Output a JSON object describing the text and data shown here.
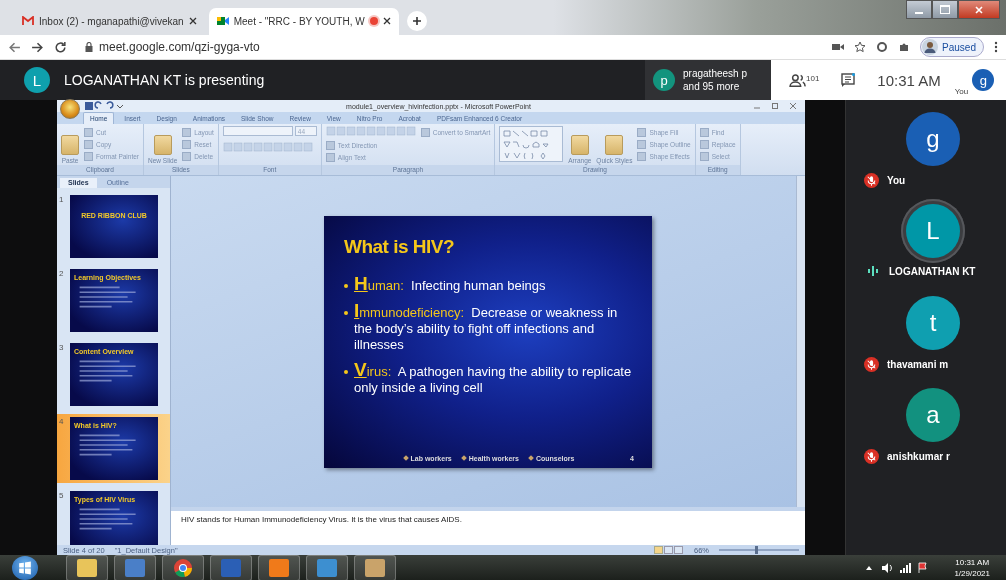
{
  "browser": {
    "tabs": [
      {
        "title": "Inbox (2) - mganapathi@vivekan",
        "selected": false,
        "recording": false
      },
      {
        "title": "Meet - \"RRC - BY YOUTH, W",
        "selected": true,
        "recording": true
      }
    ],
    "url": "meet.google.com/qzi-gyga-vto",
    "profile_status": "Paused"
  },
  "meet_bar": {
    "presenter_initial": "L",
    "presenting_text": "LOGANATHAN KT is presenting",
    "others_initial": "p",
    "others_name": "pragatheesh p",
    "others_more": "and 95 more",
    "participant_count": "101",
    "time": "10:31 AM",
    "self_label": "You",
    "self_initial": "g"
  },
  "powerpoint": {
    "title": "module1_overview_hivinfection.pptx - Microsoft PowerPoint",
    "ribbon_tabs": [
      {
        "label": "Home",
        "selected": true
      },
      {
        "label": "Insert",
        "selected": false
      },
      {
        "label": "Design",
        "selected": false
      },
      {
        "label": "Animations",
        "selected": false
      },
      {
        "label": "Slide Show",
        "selected": false
      },
      {
        "label": "Review",
        "selected": false
      },
      {
        "label": "View",
        "selected": false
      },
      {
        "label": "Nitro Pro",
        "selected": false
      },
      {
        "label": "Acrobat",
        "selected": false
      },
      {
        "label": "PDFsam Enhanced 6 Creator",
        "selected": false
      }
    ],
    "ribbon_groups": [
      {
        "label": "Clipboard",
        "items": [
          {
            "kind": "large",
            "label": "Paste"
          },
          {
            "kind": "small",
            "label": "Cut"
          },
          {
            "kind": "small",
            "label": "Copy"
          },
          {
            "kind": "small",
            "label": "Format Painter"
          }
        ]
      },
      {
        "label": "Slides",
        "items": [
          {
            "kind": "large",
            "label": "New Slide"
          },
          {
            "kind": "small",
            "label": "Layout"
          },
          {
            "kind": "small",
            "label": "Reset"
          },
          {
            "kind": "small",
            "label": "Delete"
          }
        ]
      },
      {
        "label": "Font",
        "items": [
          {
            "kind": "combo",
            "label": "44"
          },
          {
            "kind": "toolbar"
          }
        ]
      },
      {
        "label": "Paragraph",
        "items": [
          {
            "kind": "toolbar"
          },
          {
            "kind": "small",
            "label": "Text Direction"
          },
          {
            "kind": "small",
            "label": "Align Text"
          },
          {
            "kind": "small",
            "label": "Convert to SmartArt"
          }
        ]
      },
      {
        "label": "Drawing",
        "items": [
          {
            "kind": "gallery"
          },
          {
            "kind": "large",
            "label": "Arrange"
          },
          {
            "kind": "large",
            "label": "Quick Styles"
          },
          {
            "kind": "small",
            "label": "Shape Fill"
          },
          {
            "kind": "small",
            "label": "Shape Outline"
          },
          {
            "kind": "small",
            "label": "Shape Effects"
          }
        ]
      },
      {
        "label": "Editing",
        "items": [
          {
            "kind": "small",
            "label": "Find"
          },
          {
            "kind": "small",
            "label": "Replace"
          },
          {
            "kind": "small",
            "label": "Select"
          }
        ]
      }
    ],
    "pane_tabs": [
      {
        "label": "Slides",
        "selected": true
      },
      {
        "label": "Outline",
        "selected": false
      }
    ],
    "thumbnails": [
      {
        "number": "1",
        "title": "RED RIBBON CLUB",
        "selected": false
      },
      {
        "number": "2",
        "title": "Learning Objectives",
        "selected": false
      },
      {
        "number": "3",
        "title": "Content Overview",
        "selected": false
      },
      {
        "number": "4",
        "title": "What is HIV?",
        "selected": true
      },
      {
        "number": "5",
        "title": "Types of HIV Virus",
        "selected": false
      }
    ],
    "slide": {
      "title": "What is HIV?",
      "bullets": [
        {
          "initial": "H",
          "term": "uman:",
          "text": "Infecting human beings"
        },
        {
          "initial": "I",
          "term": "mmunodeficiency:",
          "text": "Decrease or weakness in the body’s ability to fight off infections and illnesses"
        },
        {
          "initial": "V",
          "term": "irus:",
          "text": "A pathogen having the ability to replicate only inside a living cell"
        }
      ],
      "footer": [
        "Lab workers",
        "Health workers",
        "Counselors"
      ],
      "number": "4"
    },
    "notes": "HIV stands for Human Immunodeficiency Virus.  It is the virus that causes AIDS.",
    "status": {
      "slide": "Slide 4 of 20",
      "theme": "\"1_Default Design\"",
      "zoom": "66%",
      "zoom_slider": {
        "level": 0.45
      }
    }
  },
  "participants": [
    {
      "initial": "g",
      "name": "You",
      "color": "#1a5fb4",
      "muted": true,
      "speaking": false
    },
    {
      "initial": "L",
      "name": "LOGANATHAN KT",
      "color": "#0097a7",
      "muted": false,
      "speaking": true
    },
    {
      "initial": "t",
      "name": "thavamani m",
      "color": "#0f9fb0",
      "muted": true,
      "speaking": false
    },
    {
      "initial": "a",
      "name": "anishkumar r",
      "color": "#12917f",
      "muted": true,
      "speaking": false
    }
  ],
  "taskbar": {
    "apps": [
      {
        "kind": "folder"
      },
      {
        "kind": "media"
      },
      {
        "kind": "chrome"
      },
      {
        "kind": "word"
      },
      {
        "kind": "pdf"
      },
      {
        "kind": "photo"
      },
      {
        "kind": "paint"
      }
    ],
    "time": "10:31 AM",
    "date": "1/29/2021"
  }
}
